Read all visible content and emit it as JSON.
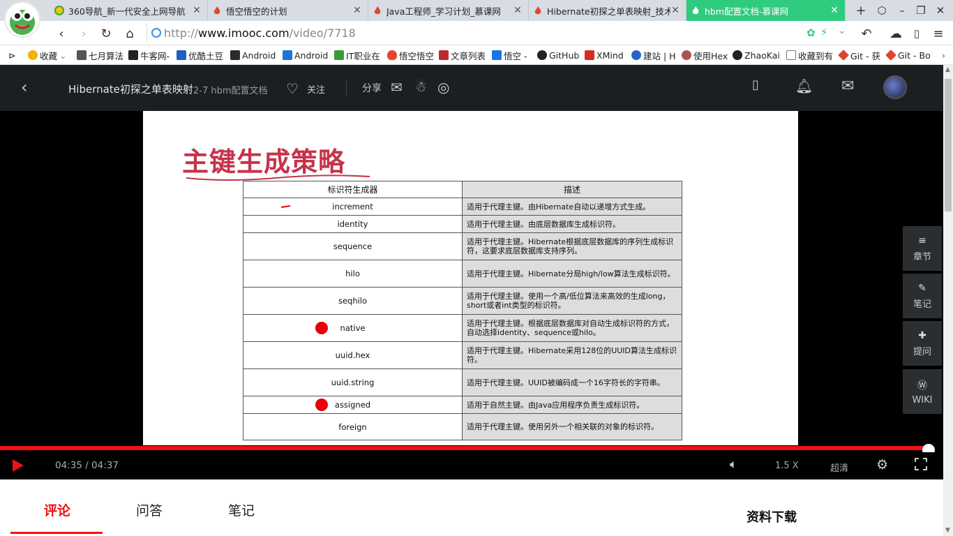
{
  "browser": {
    "tabs": [
      {
        "label": "360导航_新一代安全上网导航",
        "active": false
      },
      {
        "label": "悟空悟空的计划",
        "active": false
      },
      {
        "label": "Java工程师_学习计划_慕课网",
        "active": false
      },
      {
        "label": "Hibernate初探之单表映射_技术",
        "active": false
      },
      {
        "label": "hbm配置文档-慕课网",
        "active": true
      }
    ],
    "new_tab": "+",
    "url_prefix": "http://",
    "url_host": "www.imooc.com",
    "url_path": "/video/7718",
    "bookmarks": [
      {
        "label": "收藏",
        "color": "#f2b300"
      },
      {
        "label": "七月算法",
        "color": "#555"
      },
      {
        "label": "牛客网-",
        "color": "#222"
      },
      {
        "label": "优酷土豆",
        "color": "#1f5fbd"
      },
      {
        "label": "Android",
        "color": "#2b2b2b"
      },
      {
        "label": "Android",
        "color": "#1976d2"
      },
      {
        "label": "IT职业在",
        "color": "#3c9a33"
      },
      {
        "label": "悟空悟空",
        "color": "#e5462b"
      },
      {
        "label": "文章列表",
        "color": "#c0282d"
      },
      {
        "label": "悟空 -",
        "color": "#1a73e8"
      },
      {
        "label": "GitHub",
        "color": "#222"
      },
      {
        "label": "XMind",
        "color": "#d62b25"
      },
      {
        "label": "建站 | H",
        "color": "#2a63c6"
      },
      {
        "label": "使用Hex",
        "color": "#a55"
      },
      {
        "label": "ZhaoKai",
        "color": "#222"
      },
      {
        "label": "收藏到有",
        "color": "#777"
      },
      {
        "label": "Git - 获",
        "color": "#e0452c"
      },
      {
        "label": "Git - Bo",
        "color": "#e0452c"
      }
    ]
  },
  "header": {
    "course_title": "Hibernate初探之单表映射",
    "lesson": "2-7 hbm配置文档",
    "follow": "关注",
    "share": "分享"
  },
  "slide": {
    "title": "主键生成策略",
    "col1_header": "标识符生成器",
    "col2_header": "描述",
    "rows": [
      {
        "name": "increment",
        "desc": "适用于代理主键。由Hibernate自动以递增方式生成。",
        "marked": false
      },
      {
        "name": "identity",
        "desc": "适用于代理主键。由底层数据库生成标识符。",
        "marked": false
      },
      {
        "name": "sequence",
        "desc": "适用于代理主键。Hibernate根据底层数据库的序列生成标识符，这要求底层数据库支持序列。",
        "marked": false
      },
      {
        "name": "hilo",
        "desc": "适用于代理主键。Hibernate分局high/low算法生成标识符。",
        "marked": false
      },
      {
        "name": "seqhilo",
        "desc": "适用于代理主键。使用一个高/低位算法来高效的生成long，short或者int类型的标识符。",
        "marked": false
      },
      {
        "name": "native",
        "desc": "适用于代理主键。根据底层数据库对自动生成标识符的方式，自动选择identity、sequence或hilo。",
        "marked": true
      },
      {
        "name": "uuid.hex",
        "desc": "适用于代理主键。Hibernate采用128位的UUID算法生成标识符。",
        "marked": false
      },
      {
        "name": "uuid.string",
        "desc": "适用于代理主键。UUID被编码成一个16字符长的字符串。",
        "marked": false
      },
      {
        "name": "assigned",
        "desc": "适用于自然主键。由Java应用程序负责生成标识符。",
        "marked": true
      },
      {
        "name": "foreign",
        "desc": "适用于代理主键。使用另外一个相关联的对象的标识符。",
        "marked": false
      }
    ]
  },
  "side_buttons": [
    {
      "label": "章节",
      "icon": "≡"
    },
    {
      "label": "笔记",
      "icon": "✎"
    },
    {
      "label": "提问",
      "icon": "✚"
    },
    {
      "label": "WIKI",
      "icon": "Ⓦ"
    }
  ],
  "player": {
    "time": "04:35 / 04:37",
    "progress": 0.993,
    "speed": "1.5 X",
    "quality": "超清"
  },
  "content_tabs": [
    "评论",
    "问答",
    "笔记"
  ],
  "downloads": "资料下载",
  "colors": {
    "brand_green": "#2fcb7e",
    "accent_red": "#e11",
    "header_bg": "#1c1f21",
    "slide_title": "#c6334a"
  }
}
